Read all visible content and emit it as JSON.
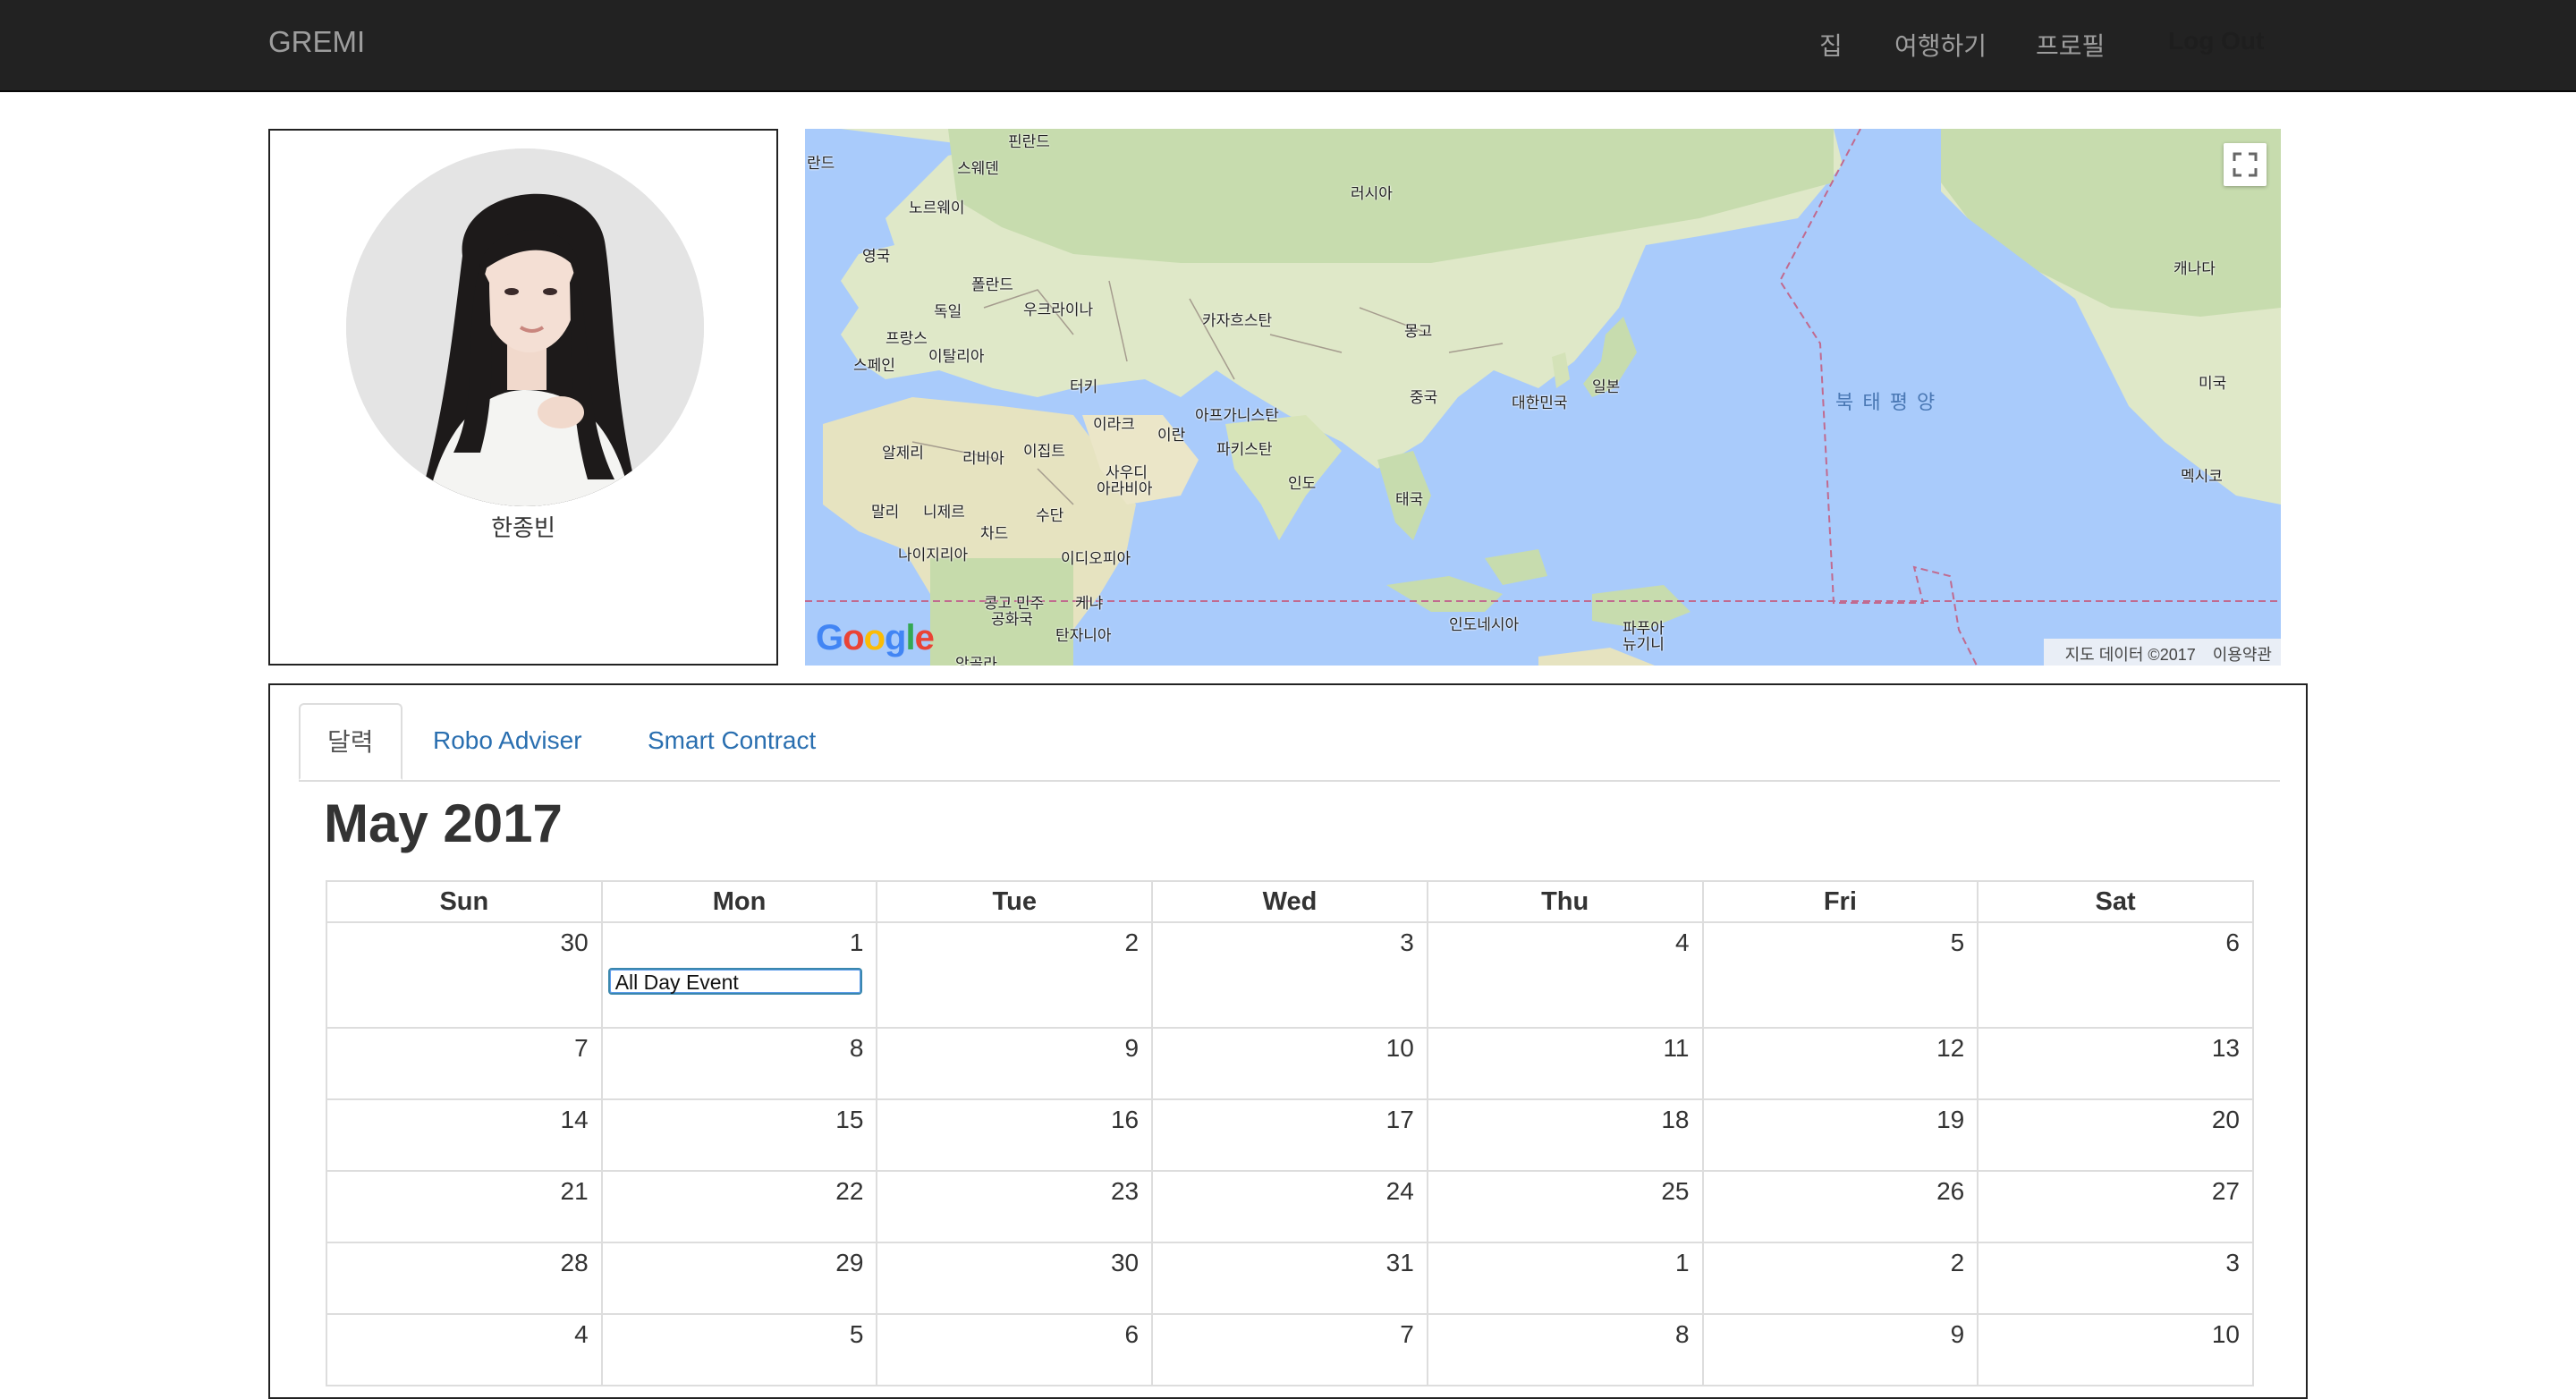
{
  "navbar": {
    "brand": "GREMI",
    "items": [
      "집",
      "여행하기",
      "프로필"
    ],
    "logout": "Log Out"
  },
  "profile": {
    "name": "한종빈"
  },
  "map": {
    "labels": [
      {
        "id": "finland",
        "text": "핀란드"
      },
      {
        "id": "iceland",
        "text": "란드"
      },
      {
        "id": "sweden",
        "text": "스웨덴"
      },
      {
        "id": "norway",
        "text": "노르웨이"
      },
      {
        "id": "russia",
        "text": "러시아"
      },
      {
        "id": "uk",
        "text": "영국"
      },
      {
        "id": "poland",
        "text": "폴란드"
      },
      {
        "id": "germany",
        "text": "독일"
      },
      {
        "id": "ukraine",
        "text": "우크라이나"
      },
      {
        "id": "kazakhstan",
        "text": "카자흐스탄"
      },
      {
        "id": "mongolia",
        "text": "몽고"
      },
      {
        "id": "france",
        "text": "프랑스"
      },
      {
        "id": "italy",
        "text": "이탈리아"
      },
      {
        "id": "spain",
        "text": "스페인"
      },
      {
        "id": "turkey",
        "text": "터키"
      },
      {
        "id": "china",
        "text": "중국"
      },
      {
        "id": "korea",
        "text": "대한민국"
      },
      {
        "id": "japan",
        "text": "일본"
      },
      {
        "id": "iraq",
        "text": "이라크"
      },
      {
        "id": "afghanistan",
        "text": "아프가니스탄"
      },
      {
        "id": "iran",
        "text": "이란"
      },
      {
        "id": "pakistan",
        "text": "파키스탄"
      },
      {
        "id": "algeria",
        "text": "알제리"
      },
      {
        "id": "libya",
        "text": "리비아"
      },
      {
        "id": "egypt",
        "text": "이집트"
      },
      {
        "id": "saudi1",
        "text": "사우디"
      },
      {
        "id": "saudi2",
        "text": "아라비아"
      },
      {
        "id": "india",
        "text": "인도"
      },
      {
        "id": "thailand",
        "text": "태국"
      },
      {
        "id": "mali",
        "text": "말리"
      },
      {
        "id": "niger",
        "text": "니제르"
      },
      {
        "id": "sudan",
        "text": "수단"
      },
      {
        "id": "chad",
        "text": "차드"
      },
      {
        "id": "nigeria",
        "text": "나이지리아"
      },
      {
        "id": "ethiopia",
        "text": "이디오피아"
      },
      {
        "id": "congo1",
        "text": "콩고 민주"
      },
      {
        "id": "congo2",
        "text": "공화국"
      },
      {
        "id": "kenya",
        "text": "케냐"
      },
      {
        "id": "tanzania",
        "text": "탄자니아"
      },
      {
        "id": "angola",
        "text": "앙골라"
      },
      {
        "id": "indonesia",
        "text": "인도네시아"
      },
      {
        "id": "png1",
        "text": "파푸아"
      },
      {
        "id": "png2",
        "text": "뉴기니"
      },
      {
        "id": "canada",
        "text": "캐나다"
      },
      {
        "id": "usa",
        "text": "미국"
      },
      {
        "id": "mexico",
        "text": "멕시코"
      }
    ],
    "ocean": "북 태 평 양",
    "logo": "Google",
    "data_credit": "지도 데이터 ©2017",
    "terms": "이용약관"
  },
  "tabs": [
    "달력",
    "Robo Adviser",
    "Smart Contract"
  ],
  "calendar": {
    "title": "May 2017",
    "days": [
      "Sun",
      "Mon",
      "Tue",
      "Wed",
      "Thu",
      "Fri",
      "Sat"
    ],
    "weeks": [
      [
        "30",
        "1",
        "2",
        "3",
        "4",
        "5",
        "6"
      ],
      [
        "7",
        "8",
        "9",
        "10",
        "11",
        "12",
        "13"
      ],
      [
        "14",
        "15",
        "16",
        "17",
        "18",
        "19",
        "20"
      ],
      [
        "21",
        "22",
        "23",
        "24",
        "25",
        "26",
        "27"
      ],
      [
        "28",
        "29",
        "30",
        "31",
        "1",
        "2",
        "3"
      ],
      [
        "4",
        "5",
        "6",
        "7",
        "8",
        "9",
        "10"
      ]
    ],
    "event": "All Day Event"
  }
}
